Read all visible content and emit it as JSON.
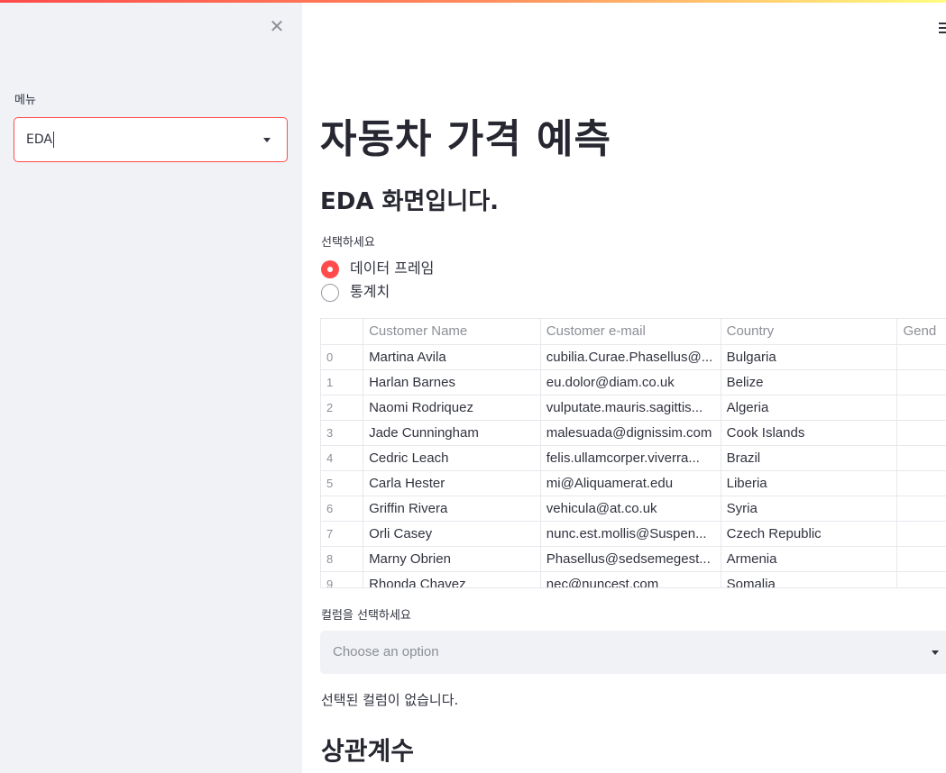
{
  "sidebar": {
    "close_icon": "close-icon",
    "menu_label": "메뉴",
    "menu_value": "EDA"
  },
  "header": {
    "menu_icon": "hamburger-icon"
  },
  "main": {
    "title": "자동차 가격 예측",
    "subtitle": "EDA 화면입니다.",
    "radio_label": "선택하세요",
    "radio_options": [
      "데이터 프레임",
      "통계치"
    ],
    "radio_selected": 0,
    "table": {
      "columns": [
        "",
        "Customer Name",
        "Customer e-mail",
        "Country",
        "Gend"
      ],
      "rows": [
        [
          "0",
          "Martina Avila",
          "cubilia.Curae.Phasellus@...",
          "Bulgaria",
          ""
        ],
        [
          "1",
          "Harlan Barnes",
          "eu.dolor@diam.co.uk",
          "Belize",
          ""
        ],
        [
          "2",
          "Naomi Rodriquez",
          "vulputate.mauris.sagittis...",
          "Algeria",
          ""
        ],
        [
          "3",
          "Jade Cunningham",
          "malesuada@dignissim.com",
          "Cook Islands",
          ""
        ],
        [
          "4",
          "Cedric Leach",
          "felis.ullamcorper.viverra...",
          "Brazil",
          ""
        ],
        [
          "5",
          "Carla Hester",
          "mi@Aliquamerat.edu",
          "Liberia",
          ""
        ],
        [
          "6",
          "Griffin Rivera",
          "vehicula@at.co.uk",
          "Syria",
          ""
        ],
        [
          "7",
          "Orli Casey",
          "nunc.est.mollis@Suspen...",
          "Czech Republic",
          ""
        ],
        [
          "8",
          "Marny Obrien",
          "Phasellus@sedsemegest...",
          "Armenia",
          ""
        ],
        [
          "9",
          "Rhonda Chavez",
          "nec@nuncest.com",
          "Somalia",
          ""
        ]
      ]
    },
    "column_select_label": "컬럼을 선택하세요",
    "column_select_placeholder": "Choose an option",
    "status_text": "선택된 컬럼이 없습니다.",
    "section_title": "상관계수"
  },
  "colors": {
    "accent": "#ff4b4b",
    "sidebar_bg": "#f0f2f6",
    "text": "#31333f"
  }
}
